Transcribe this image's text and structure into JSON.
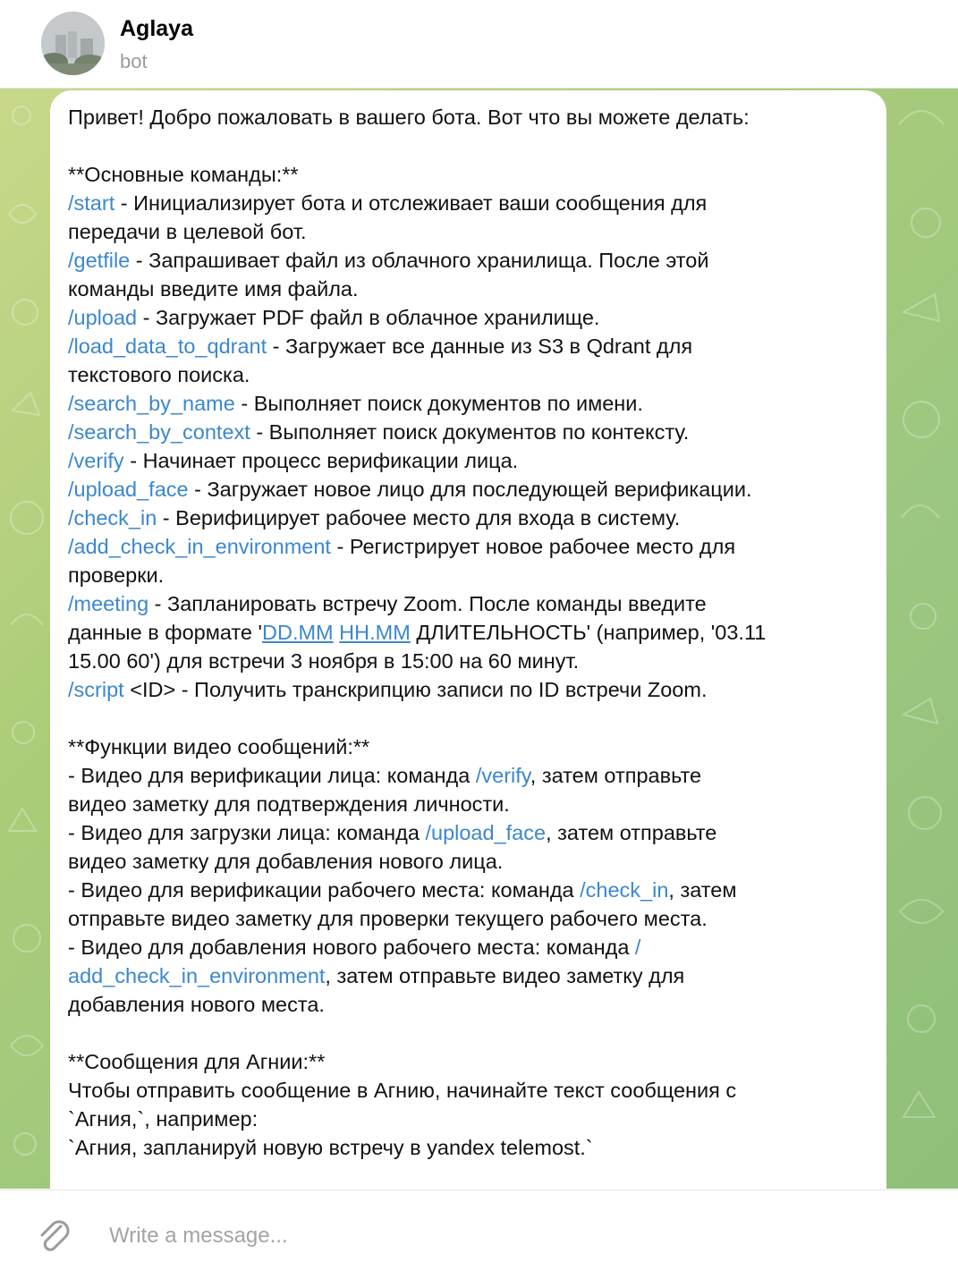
{
  "header": {
    "name": "Aglaya",
    "status": "bot"
  },
  "message": {
    "lines": [
      [
        {
          "t": "Привет! Добро пожаловать в вашего бота. Вот что вы можете делать:"
        }
      ],
      [],
      [
        {
          "t": "**Основные команды:**"
        }
      ],
      [
        {
          "t": "/start",
          "k": "cmd"
        },
        {
          "t": " - Инициализирует бота и отслеживает ваши сообщения для"
        }
      ],
      [
        {
          "t": "передачи в целевой бот."
        }
      ],
      [
        {
          "t": "/getfile",
          "k": "cmd"
        },
        {
          "t": " - Запрашивает файл из облачного хранилища. После этой"
        }
      ],
      [
        {
          "t": "команды введите имя файла."
        }
      ],
      [
        {
          "t": "/upload",
          "k": "cmd"
        },
        {
          "t": " - Загружает PDF файл в облачное хранилище."
        }
      ],
      [
        {
          "t": "/load_data_to_qdrant",
          "k": "cmd"
        },
        {
          "t": " - Загружает все данные из S3 в Qdrant для"
        }
      ],
      [
        {
          "t": "текстового поиска."
        }
      ],
      [
        {
          "t": "/search_by_name",
          "k": "cmd"
        },
        {
          "t": " - Выполняет поиск документов по имени."
        }
      ],
      [
        {
          "t": "/search_by_context",
          "k": "cmd"
        },
        {
          "t": " - Выполняет поиск документов по контексту."
        }
      ],
      [
        {
          "t": "/verify",
          "k": "cmd"
        },
        {
          "t": " - Начинает процесс верификации лица."
        }
      ],
      [
        {
          "t": "/upload_face",
          "k": "cmd"
        },
        {
          "t": " - Загружает новое лицо для последующей верификации."
        }
      ],
      [
        {
          "t": "/check_in",
          "k": "cmd"
        },
        {
          "t": " - Верифицирует рабочее место для входа в систему."
        }
      ],
      [
        {
          "t": "/add_check_in_environment",
          "k": "cmd"
        },
        {
          "t": " - Регистрирует новое рабочее место для"
        }
      ],
      [
        {
          "t": "проверки."
        }
      ],
      [
        {
          "t": "/meeting",
          "k": "cmd"
        },
        {
          "t": " - Запланировать встречу Zoom. После команды введите"
        }
      ],
      [
        {
          "t": "данные в формате '"
        },
        {
          "t": "DD.MM",
          "k": "link"
        },
        {
          "t": " "
        },
        {
          "t": "HH.MM",
          "k": "link"
        },
        {
          "t": " ДЛИТЕЛЬНОСТЬ' (например, '03.11"
        }
      ],
      [
        {
          "t": "15.00 60') для встречи 3 ноября в 15:00 на 60 минут."
        }
      ],
      [
        {
          "t": "/script",
          "k": "cmd"
        },
        {
          "t": " <ID> - Получить транскрипцию записи по ID встречи Zoom."
        }
      ],
      [],
      [
        {
          "t": "**Функции видео сообщений:**"
        }
      ],
      [
        {
          "t": "- Видео для верификации лица: команда "
        },
        {
          "t": "/verify",
          "k": "cmd"
        },
        {
          "t": ", затем отправьте"
        }
      ],
      [
        {
          "t": "видео заметку для подтверждения личности."
        }
      ],
      [
        {
          "t": "- Видео для загрузки лица: команда "
        },
        {
          "t": "/upload_face",
          "k": "cmd"
        },
        {
          "t": ", затем отправьте"
        }
      ],
      [
        {
          "t": "видео заметку для добавления нового лица."
        }
      ],
      [
        {
          "t": "- Видео для верификации рабочего места: команда "
        },
        {
          "t": "/check_in",
          "k": "cmd"
        },
        {
          "t": ", затем"
        }
      ],
      [
        {
          "t": "отправьте видео заметку для проверки текущего рабочего места."
        }
      ],
      [
        {
          "t": "- Видео для добавления нового рабочего места: команда "
        },
        {
          "t": "/",
          "k": "cmd"
        }
      ],
      [
        {
          "t": "add_check_in_environment",
          "k": "cmd"
        },
        {
          "t": ", затем отправьте видео заметку для"
        }
      ],
      [
        {
          "t": "добавления нового места."
        }
      ],
      [],
      [
        {
          "t": "**Сообщения для Агнии:**"
        }
      ],
      [
        {
          "t": "Чтобы отправить сообщение в Агнию, начинайте текст сообщения с"
        }
      ],
      [
        {
          "t": "`Агния,`, например:"
        }
      ],
      [
        {
          "t": "`Агния, запланируй новую встречу в yandex telemost.`"
        }
      ]
    ]
  },
  "composer": {
    "placeholder": "Write a message...",
    "attach_icon": "paperclip-icon"
  },
  "colors": {
    "link": "#3b87cf",
    "background_start": "#c8d88a",
    "background_end": "#8fbf78"
  }
}
